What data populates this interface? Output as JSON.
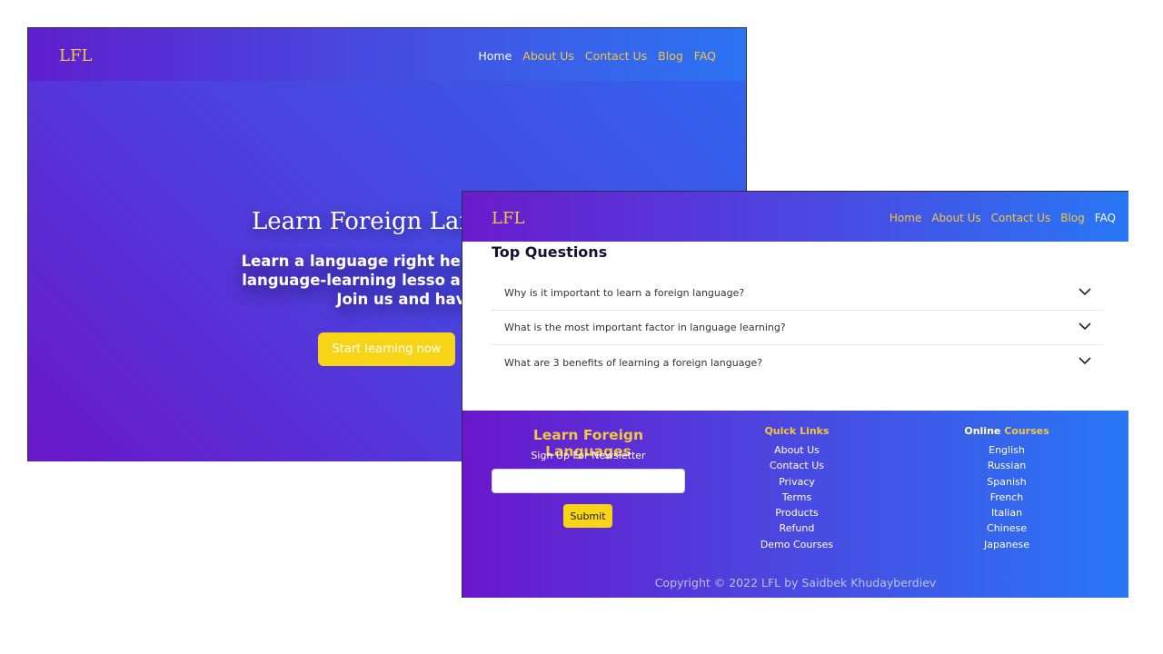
{
  "brand": {
    "logo": "LFL"
  },
  "hero_page": {
    "nav": [
      {
        "label": "Home",
        "active": true
      },
      {
        "label": "About Us",
        "active": false
      },
      {
        "label": "Contact Us",
        "active": false
      },
      {
        "label": "Blog",
        "active": false
      },
      {
        "label": "FAQ",
        "active": false
      }
    ],
    "title": "Learn Foreign Lang",
    "subtitle": "Learn a language right here wit of free language-learning lesso and activities. Join us and have",
    "cta": "Start learning now"
  },
  "faq_page": {
    "nav": [
      {
        "label": "Home",
        "active": false
      },
      {
        "label": "About Us",
        "active": false
      },
      {
        "label": "Contact Us",
        "active": false
      },
      {
        "label": "Blog",
        "active": false
      },
      {
        "label": "FAQ",
        "active": true
      }
    ],
    "section_title": "Top Questions",
    "questions": [
      "Why is it important to learn a foreign language?",
      "What is the most important factor in language learning?",
      "What are 3 benefits of learning a foreign language?"
    ],
    "footer": {
      "brand": "Learn Foreign Languages",
      "newsletter_label": "Sign Up For Newsletter",
      "newsletter_placeholder": "",
      "submit": "Submit",
      "quick_links_title": "Quick Links",
      "quick_links": [
        "About Us",
        "Contact Us",
        "Privacy",
        "Terms",
        "Products",
        "Refund",
        "Demo Courses"
      ],
      "courses_title_highlight": "Online",
      "courses_title_rest": " Courses",
      "courses": [
        "English",
        "Russian",
        "Spanish",
        "French",
        "Italian",
        "Chinese",
        "Japanese"
      ],
      "copyright": "Copyright © 2022 LFL by Saidbek Khudayberdiev"
    }
  },
  "colors": {
    "accent_yellow": "#f8d417",
    "link_gold": "#f3c642",
    "gradient_start": "#6a17cc",
    "gradient_end": "#2877f5"
  }
}
